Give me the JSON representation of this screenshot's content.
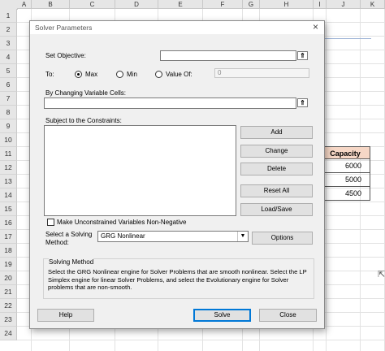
{
  "sheet": {
    "columns": [
      "A",
      "B",
      "C",
      "D",
      "E",
      "F",
      "G",
      "H",
      "I",
      "J",
      "K"
    ],
    "rows": [
      "1",
      "2",
      "3",
      "4",
      "5",
      "6",
      "7",
      "8",
      "9",
      "10",
      "11",
      "12",
      "13",
      "14",
      "15",
      "16",
      "17",
      "18",
      "19",
      "20",
      "21",
      "22",
      "23",
      "24"
    ],
    "capacity_header": "Capacity",
    "capacity_values": [
      "6000",
      "5000",
      "4500"
    ]
  },
  "dialog": {
    "title": "Solver Parameters",
    "close": "×",
    "set_objective_label": "Set Objective:",
    "to_label": "To:",
    "radio_max": "Max",
    "radio_min": "Min",
    "radio_value_of": "Value Of:",
    "value_of_value": "0",
    "selected_radio": "Max",
    "changing_cells_label": "By Changing Variable Cells:",
    "constraints_label": "Subject to the Constraints:",
    "buttons": {
      "add": "Add",
      "change": "Change",
      "delete": "Delete",
      "reset_all": "Reset All",
      "load_save": "Load/Save",
      "options": "Options",
      "help": "Help",
      "solve": "Solve",
      "close": "Close"
    },
    "unconstrained_label": "Make Unconstrained Variables Non-Negative",
    "unconstrained_checked": false,
    "solving_method_label_1": "Select a Solving",
    "solving_method_label_2": "Method:",
    "solving_method_value": "GRG Nonlinear",
    "solving_method_group_title": "Solving Method",
    "solving_method_description": "Select the GRG Nonlinear engine for Solver Problems that are smooth nonlinear. Select the LP Simplex engine for linear Solver Problems, and select the Evolutionary engine for Solver problems that are non-smooth."
  }
}
